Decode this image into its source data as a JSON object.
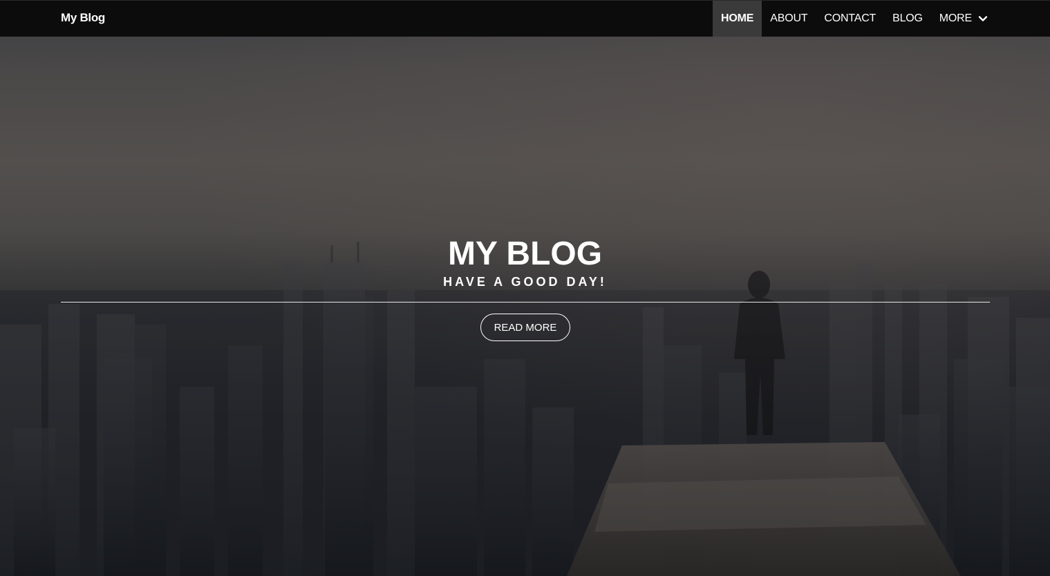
{
  "navbar": {
    "brand": "My Blog",
    "items": [
      {
        "label": "HOME",
        "active": true
      },
      {
        "label": "ABOUT",
        "active": false
      },
      {
        "label": "CONTACT",
        "active": false
      },
      {
        "label": "BLOG",
        "active": false
      },
      {
        "label": "MORE",
        "active": false,
        "icon": "chevron-down-icon"
      }
    ]
  },
  "hero": {
    "title": "MY BLOG",
    "subtitle": "HAVE A GOOD DAY!",
    "cta_label": "READ MORE"
  },
  "colors": {
    "navbar_bg": "#0c0c0c",
    "active_nav_bg": "#3a3a3a",
    "text": "#ffffff"
  }
}
